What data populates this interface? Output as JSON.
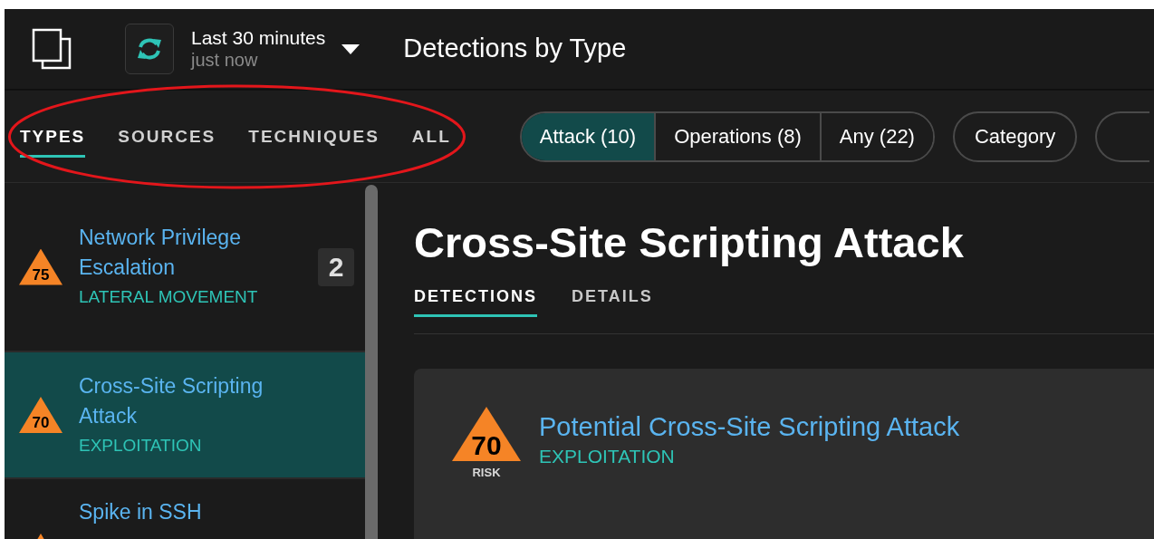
{
  "header": {
    "time_range": "Last 30 minutes",
    "updated": "just now",
    "title": "Detections by Type"
  },
  "view_tabs": [
    {
      "label": "TYPES",
      "selected": true
    },
    {
      "label": "SOURCES",
      "selected": false
    },
    {
      "label": "TECHNIQUES",
      "selected": false
    },
    {
      "label": "ALL",
      "selected": false
    }
  ],
  "filter_segments": [
    {
      "label": "Attack (10)",
      "selected": true
    },
    {
      "label": "Operations (8)",
      "selected": false
    },
    {
      "label": "Any (22)",
      "selected": false
    }
  ],
  "filter_buttons": [
    "Category"
  ],
  "sidebar": {
    "items": [
      {
        "title": "Network Privilege Escalation",
        "category": "LATERAL MOVEMENT",
        "risk": "75",
        "count": "2",
        "selected": false
      },
      {
        "title": "Cross-Site Scripting Attack",
        "category": "EXPLOITATION",
        "risk": "70",
        "selected": true
      },
      {
        "title": "Spike in SSH",
        "selected": false
      }
    ]
  },
  "detail": {
    "title": "Cross-Site Scripting Attack",
    "tabs": [
      {
        "label": "DETECTIONS",
        "selected": true
      },
      {
        "label": "DETAILS",
        "selected": false
      }
    ],
    "detections": [
      {
        "risk": "70",
        "risk_label": "RISK",
        "title": "Potential Cross-Site Scripting Attack",
        "category": "EXPLOITATION"
      }
    ]
  }
}
